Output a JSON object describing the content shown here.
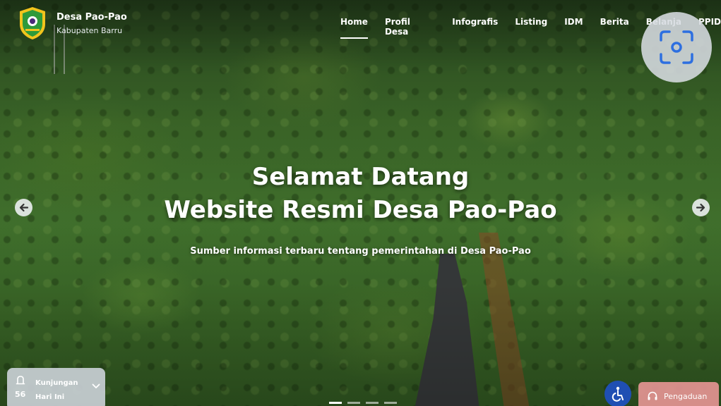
{
  "brand": {
    "name": "Desa Pao-Pao",
    "subtitle": "Kabupaten Barru",
    "logo_icon": "regency-shield-logo"
  },
  "nav": {
    "items": [
      {
        "label": "Home",
        "active": true
      },
      {
        "label": "Profil Desa"
      },
      {
        "label": "Infografis"
      },
      {
        "label": "Listing"
      },
      {
        "label": "IDM"
      },
      {
        "label": "Berita"
      },
      {
        "label": "Belanja"
      },
      {
        "label": "PPID"
      }
    ]
  },
  "hero": {
    "title_line1": "Selamat Datang",
    "title_line2": "Website Resmi Desa Pao-Pao",
    "subtitle": "Sumber informasi terbaru tentang pemerintahan di Desa Pao-Pao"
  },
  "carousel": {
    "prev_icon": "arrow-left-icon",
    "next_icon": "arrow-right-icon",
    "slide_count": 4,
    "active_slide": 1
  },
  "visit_widget": {
    "count": "56",
    "label_line1": "Kunjungan",
    "label_line2": "Hari Ini",
    "icon": "bell-icon",
    "toggle_icon": "chevron-down-icon"
  },
  "actions": {
    "accessibility_icon": "wheelchair-icon",
    "complaint_label": "Pengaduan",
    "complaint_icon": "headset-icon",
    "scan_icon": "camera-scan-icon"
  },
  "colors": {
    "accent_blue": "#1f4fb3",
    "complaint_bg": "#e89696",
    "logo_green": "#2e9a3a",
    "logo_yellow": "#f2c41c"
  }
}
